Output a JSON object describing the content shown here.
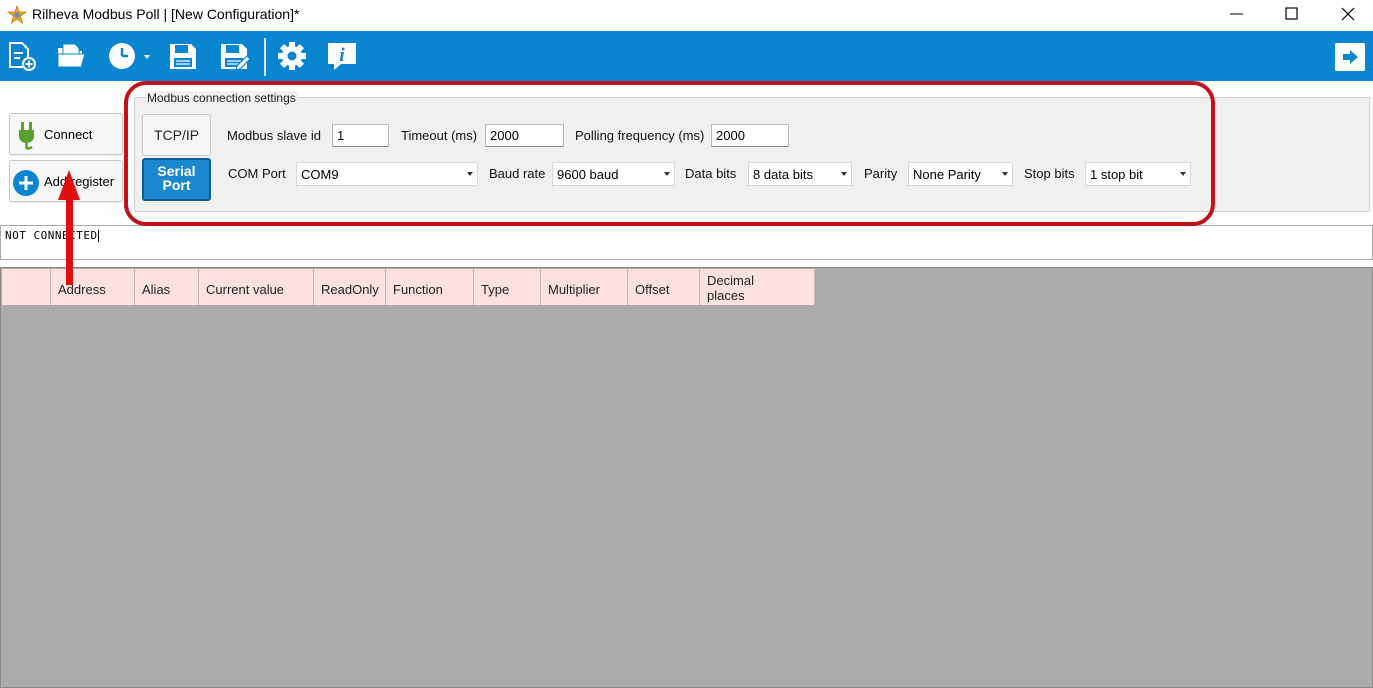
{
  "window": {
    "title": "Rilheva Modbus Poll | [New Configuration]*",
    "controls": [
      "minimize",
      "maximize",
      "close"
    ]
  },
  "toolbar": {
    "buttons": [
      "new-file-icon",
      "open-folder-icon",
      "clock-icon",
      "save-icon",
      "save-as-icon",
      "gear-icon",
      "info-icon"
    ],
    "exit_icon": "exit-arrow-icon",
    "background": "#0a86d0"
  },
  "sidebar": {
    "connect_label": "Connect",
    "add_register_label": "Add register"
  },
  "settings": {
    "group_title": "Modbus connection settings",
    "tcp_ip_label": "TCP/IP",
    "serial_label_line1": "Serial",
    "serial_label_line2": "Port",
    "slave_id_label": "Modbus slave id",
    "slave_id_value": "1",
    "timeout_label": "Timeout (ms)",
    "timeout_value": "2000",
    "polling_label": "Polling frequency (ms)",
    "polling_value": "2000",
    "com_port_label": "COM Port",
    "com_port_value": "COM9",
    "baud_label": "Baud rate",
    "baud_value": "9600 baud",
    "data_bits_label": "Data bits",
    "data_bits_value": "8 data bits",
    "parity_label": "Parity",
    "parity_value": "None Parity",
    "stop_bits_label": "Stop bits",
    "stop_bits_value": "1 stop bit"
  },
  "status": {
    "text": "NOT CONNECTED"
  },
  "grid": {
    "columns": [
      "",
      "Address",
      "Alias",
      "Current value",
      "ReadOnly",
      "Function",
      "Type",
      "Multiplier",
      "Offset"
    ],
    "decimal_line1": "Decimal",
    "decimal_line2": "places"
  },
  "colors": {
    "accent": "#0a86d0",
    "highlight": "#c1121b",
    "header_bg": "#fde1e1",
    "grid_bg": "#ababab"
  }
}
